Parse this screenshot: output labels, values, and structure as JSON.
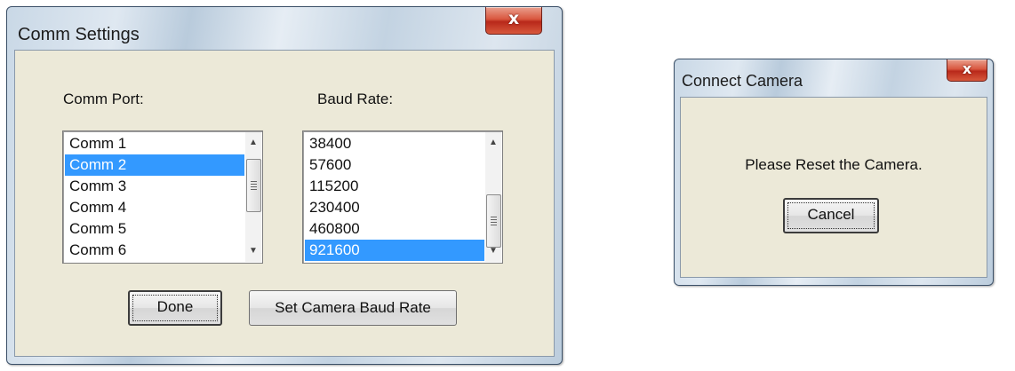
{
  "comm_dialog": {
    "title": "Comm Settings",
    "close_label": "x",
    "port_label": "Comm Port:",
    "baud_label": "Baud Rate:",
    "ports": [
      "Comm 1",
      "Comm 2",
      "Comm 3",
      "Comm 4",
      "Comm 5",
      "Comm 6"
    ],
    "selected_port": "Comm 2",
    "baud_rates": [
      "38400",
      "57600",
      "115200",
      "230400",
      "460800",
      "921600"
    ],
    "selected_baud": "921600",
    "done_label": "Done",
    "set_baud_label": "Set Camera Baud Rate"
  },
  "camera_dialog": {
    "title": "Connect Camera",
    "close_label": "x",
    "message": "Please Reset the Camera.",
    "cancel_label": "Cancel"
  },
  "colors": {
    "selection": "#3399ff",
    "close_button": "#c8402b",
    "dialog_face": "#ece9d8"
  },
  "icons": {
    "close": "close-icon",
    "scroll_up": "scroll-up-arrow-icon",
    "scroll_down": "scroll-down-arrow-icon"
  }
}
